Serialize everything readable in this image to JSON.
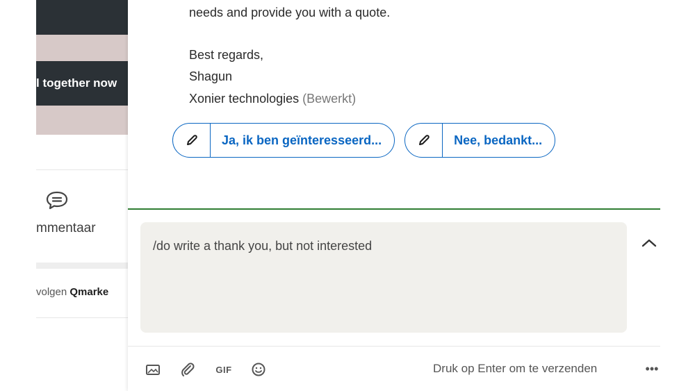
{
  "feed": {
    "banner_text": "l together now",
    "comment_label": "mmentaar",
    "follow_prefix": "volgen ",
    "follow_name": "Qmarke"
  },
  "message": {
    "lines": [
      "needs and provide you with a quote.",
      "Best regards,",
      "Shagun",
      "Xonier technologies"
    ],
    "edited_label": "(Bewerkt)"
  },
  "suggestions": [
    {
      "label": "Ja, ik ben geïnteresseerd...",
      "icon": "pencil-icon"
    },
    {
      "label": "Nee, bedankt...",
      "icon": "pencil-icon"
    }
  ],
  "composer": {
    "value": "/do write a thank you, but not interested"
  },
  "toolbar": {
    "gif_label": "GIF",
    "send_hint": "Druk op Enter om te verzenden",
    "more_label": "•••"
  },
  "colors": {
    "accent": "#0a66c2",
    "focus_line": "#2e7d32",
    "composer_bg": "#f1f0ec"
  }
}
